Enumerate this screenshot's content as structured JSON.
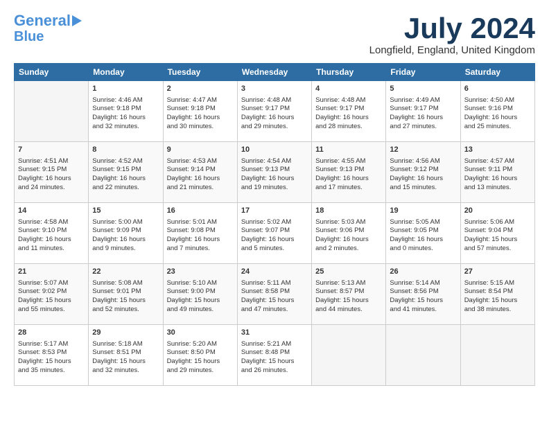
{
  "logo": {
    "line1": "General",
    "line2": "Blue"
  },
  "title": "July 2024",
  "location": "Longfield, England, United Kingdom",
  "headers": [
    "Sunday",
    "Monday",
    "Tuesday",
    "Wednesday",
    "Thursday",
    "Friday",
    "Saturday"
  ],
  "weeks": [
    [
      {
        "day": "",
        "content": ""
      },
      {
        "day": "1",
        "content": "Sunrise: 4:46 AM\nSunset: 9:18 PM\nDaylight: 16 hours\nand 32 minutes."
      },
      {
        "day": "2",
        "content": "Sunrise: 4:47 AM\nSunset: 9:18 PM\nDaylight: 16 hours\nand 30 minutes."
      },
      {
        "day": "3",
        "content": "Sunrise: 4:48 AM\nSunset: 9:17 PM\nDaylight: 16 hours\nand 29 minutes."
      },
      {
        "day": "4",
        "content": "Sunrise: 4:48 AM\nSunset: 9:17 PM\nDaylight: 16 hours\nand 28 minutes."
      },
      {
        "day": "5",
        "content": "Sunrise: 4:49 AM\nSunset: 9:17 PM\nDaylight: 16 hours\nand 27 minutes."
      },
      {
        "day": "6",
        "content": "Sunrise: 4:50 AM\nSunset: 9:16 PM\nDaylight: 16 hours\nand 25 minutes."
      }
    ],
    [
      {
        "day": "7",
        "content": "Sunrise: 4:51 AM\nSunset: 9:15 PM\nDaylight: 16 hours\nand 24 minutes."
      },
      {
        "day": "8",
        "content": "Sunrise: 4:52 AM\nSunset: 9:15 PM\nDaylight: 16 hours\nand 22 minutes."
      },
      {
        "day": "9",
        "content": "Sunrise: 4:53 AM\nSunset: 9:14 PM\nDaylight: 16 hours\nand 21 minutes."
      },
      {
        "day": "10",
        "content": "Sunrise: 4:54 AM\nSunset: 9:13 PM\nDaylight: 16 hours\nand 19 minutes."
      },
      {
        "day": "11",
        "content": "Sunrise: 4:55 AM\nSunset: 9:13 PM\nDaylight: 16 hours\nand 17 minutes."
      },
      {
        "day": "12",
        "content": "Sunrise: 4:56 AM\nSunset: 9:12 PM\nDaylight: 16 hours\nand 15 minutes."
      },
      {
        "day": "13",
        "content": "Sunrise: 4:57 AM\nSunset: 9:11 PM\nDaylight: 16 hours\nand 13 minutes."
      }
    ],
    [
      {
        "day": "14",
        "content": "Sunrise: 4:58 AM\nSunset: 9:10 PM\nDaylight: 16 hours\nand 11 minutes."
      },
      {
        "day": "15",
        "content": "Sunrise: 5:00 AM\nSunset: 9:09 PM\nDaylight: 16 hours\nand 9 minutes."
      },
      {
        "day": "16",
        "content": "Sunrise: 5:01 AM\nSunset: 9:08 PM\nDaylight: 16 hours\nand 7 minutes."
      },
      {
        "day": "17",
        "content": "Sunrise: 5:02 AM\nSunset: 9:07 PM\nDaylight: 16 hours\nand 5 minutes."
      },
      {
        "day": "18",
        "content": "Sunrise: 5:03 AM\nSunset: 9:06 PM\nDaylight: 16 hours\nand 2 minutes."
      },
      {
        "day": "19",
        "content": "Sunrise: 5:05 AM\nSunset: 9:05 PM\nDaylight: 16 hours\nand 0 minutes."
      },
      {
        "day": "20",
        "content": "Sunrise: 5:06 AM\nSunset: 9:04 PM\nDaylight: 15 hours\nand 57 minutes."
      }
    ],
    [
      {
        "day": "21",
        "content": "Sunrise: 5:07 AM\nSunset: 9:02 PM\nDaylight: 15 hours\nand 55 minutes."
      },
      {
        "day": "22",
        "content": "Sunrise: 5:08 AM\nSunset: 9:01 PM\nDaylight: 15 hours\nand 52 minutes."
      },
      {
        "day": "23",
        "content": "Sunrise: 5:10 AM\nSunset: 9:00 PM\nDaylight: 15 hours\nand 49 minutes."
      },
      {
        "day": "24",
        "content": "Sunrise: 5:11 AM\nSunset: 8:58 PM\nDaylight: 15 hours\nand 47 minutes."
      },
      {
        "day": "25",
        "content": "Sunrise: 5:13 AM\nSunset: 8:57 PM\nDaylight: 15 hours\nand 44 minutes."
      },
      {
        "day": "26",
        "content": "Sunrise: 5:14 AM\nSunset: 8:56 PM\nDaylight: 15 hours\nand 41 minutes."
      },
      {
        "day": "27",
        "content": "Sunrise: 5:15 AM\nSunset: 8:54 PM\nDaylight: 15 hours\nand 38 minutes."
      }
    ],
    [
      {
        "day": "28",
        "content": "Sunrise: 5:17 AM\nSunset: 8:53 PM\nDaylight: 15 hours\nand 35 minutes."
      },
      {
        "day": "29",
        "content": "Sunrise: 5:18 AM\nSunset: 8:51 PM\nDaylight: 15 hours\nand 32 minutes."
      },
      {
        "day": "30",
        "content": "Sunrise: 5:20 AM\nSunset: 8:50 PM\nDaylight: 15 hours\nand 29 minutes."
      },
      {
        "day": "31",
        "content": "Sunrise: 5:21 AM\nSunset: 8:48 PM\nDaylight: 15 hours\nand 26 minutes."
      },
      {
        "day": "",
        "content": ""
      },
      {
        "day": "",
        "content": ""
      },
      {
        "day": "",
        "content": ""
      }
    ]
  ]
}
